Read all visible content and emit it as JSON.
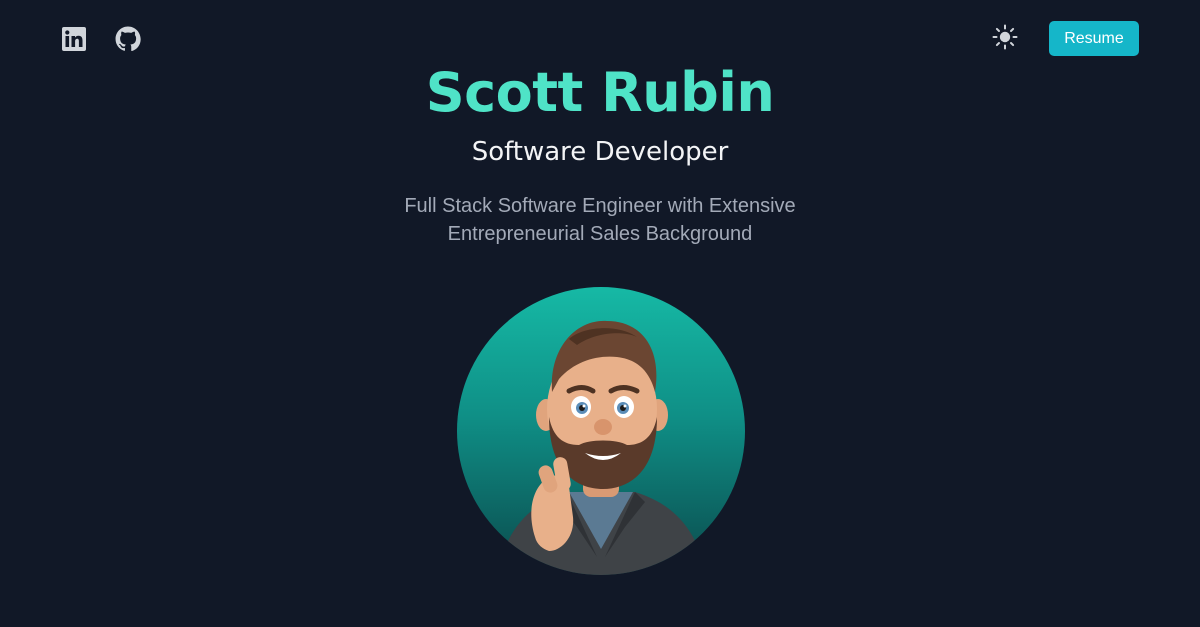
{
  "header": {
    "social_icons": [
      "linkedin-icon",
      "github-icon"
    ],
    "theme_icon": "sun-icon",
    "resume_label": "Resume"
  },
  "hero": {
    "name": "Scott Rubin",
    "role": "Software Developer",
    "tagline": "Full Stack Software Engineer with Extensive Entrepreneurial Sales Background"
  },
  "colors": {
    "background": "#111827",
    "accent": "#4fe3c7",
    "button": "#15b6c9"
  }
}
